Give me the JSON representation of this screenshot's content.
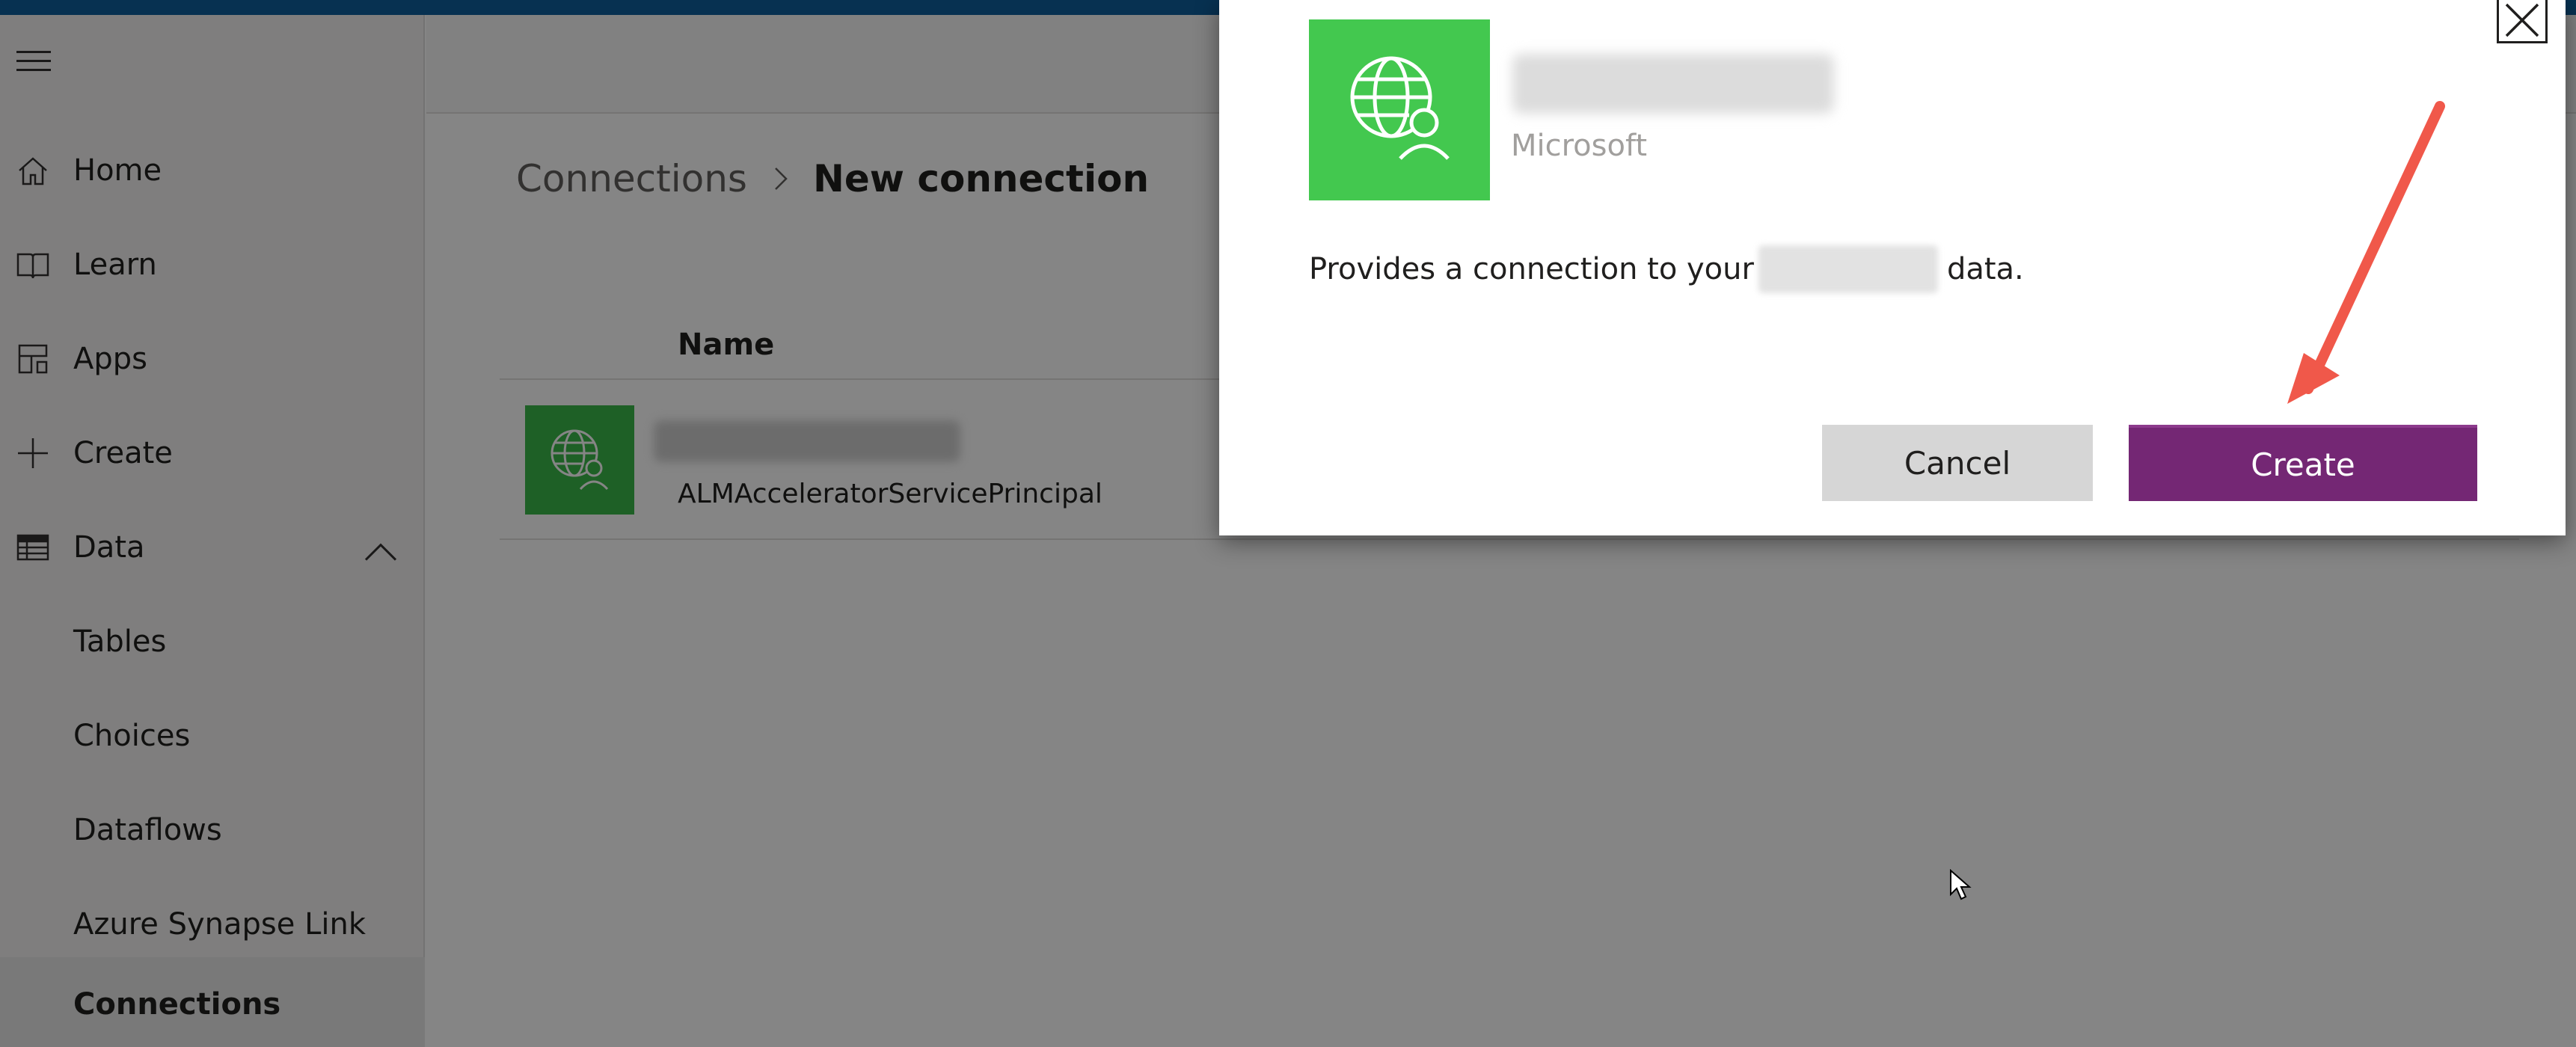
{
  "sidebar": {
    "items": [
      {
        "label": "Home",
        "icon": "home-icon"
      },
      {
        "label": "Learn",
        "icon": "book-icon"
      },
      {
        "label": "Apps",
        "icon": "apps-icon"
      },
      {
        "label": "Create",
        "icon": "plus-icon"
      },
      {
        "label": "Data",
        "icon": "table-icon"
      },
      {
        "label": "Tables"
      },
      {
        "label": "Choices"
      },
      {
        "label": "Dataflows"
      },
      {
        "label": "Azure Synapse Link"
      },
      {
        "label": "Connections",
        "selected": true
      }
    ]
  },
  "breadcrumb": {
    "parent": "Connections",
    "current": "New connection"
  },
  "list": {
    "column_name": "Name",
    "rows": [
      {
        "subtitle": "ALMAcceleratorServicePrincipal"
      }
    ]
  },
  "dialog": {
    "publisher": "Microsoft",
    "description_before": "Provides a connection to your",
    "description_after": "data.",
    "cancel_label": "Cancel",
    "create_label": "Create"
  },
  "colors": {
    "accent_purple": "#742774",
    "connector_green": "#43c84f",
    "annotation_arrow": "#f0584a"
  }
}
